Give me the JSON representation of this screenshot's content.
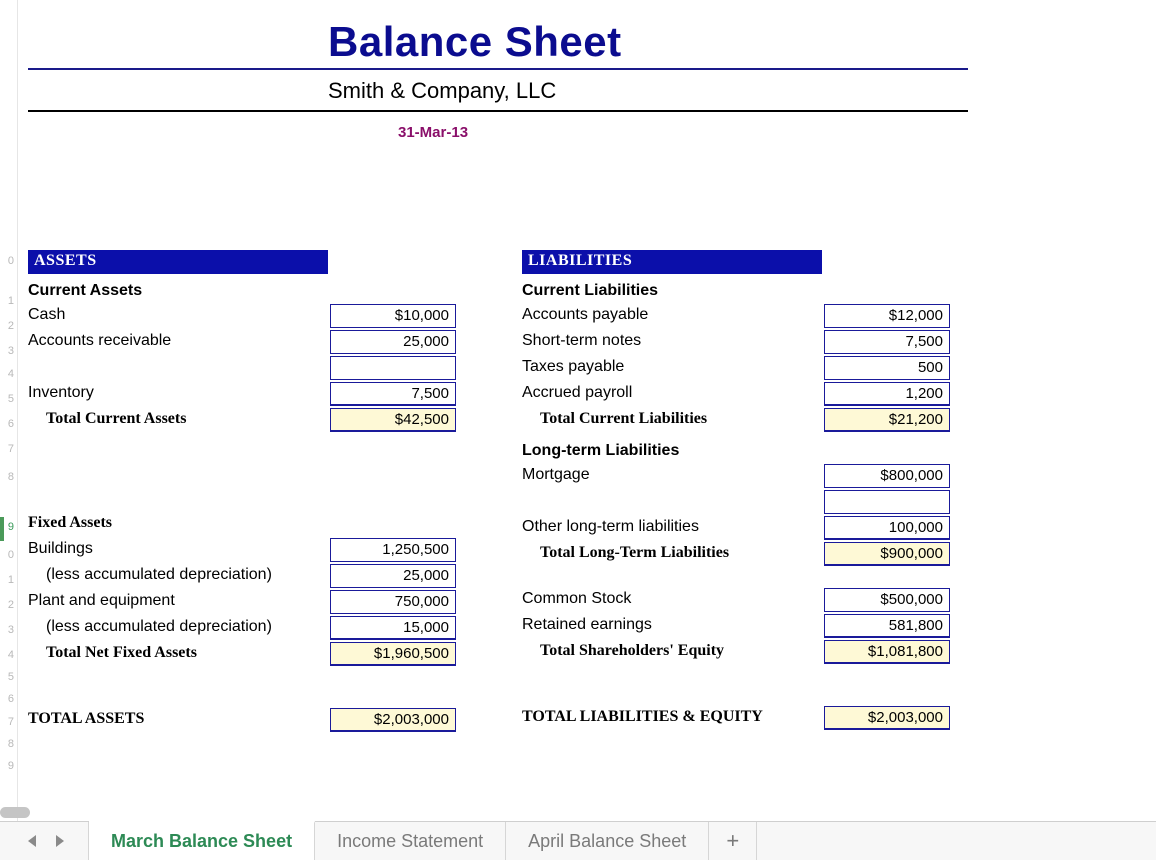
{
  "title": "Balance Sheet",
  "company": "Smith & Company, LLC",
  "date": "31-Mar-13",
  "assets": {
    "header": "ASSETS",
    "current_label": "Current Assets",
    "items": {
      "cash_label": "Cash",
      "cash_value": "$10,000",
      "ar_label": "Accounts receivable",
      "ar_value": "25,000",
      "inventory_label": "Inventory",
      "inventory_value": "7,500",
      "total_current_label": "Total Current Assets",
      "total_current_value": "$42,500"
    },
    "fixed_label": "Fixed Assets",
    "fixed": {
      "buildings_label": "Buildings",
      "buildings_value": "1,250,500",
      "buildings_dep_label": "(less accumulated depreciation)",
      "buildings_dep_value": "25,000",
      "plant_label": "Plant and equipment",
      "plant_value": "750,000",
      "plant_dep_label": "(less accumulated depreciation)",
      "plant_dep_value": "15,000",
      "total_net_label": "Total Net Fixed Assets",
      "total_net_value": "$1,960,500"
    },
    "grand_label": "TOTAL ASSETS",
    "grand_value": "$2,003,000"
  },
  "liab": {
    "header": "LIABILITIES",
    "current_label": "Current Liabilities",
    "items": {
      "ap_label": "Accounts payable",
      "ap_value": "$12,000",
      "stn_label": "Short-term notes",
      "stn_value": "7,500",
      "tax_label": "Taxes payable",
      "tax_value": "500",
      "payroll_label": "Accrued payroll",
      "payroll_value": "1,200",
      "total_current_label": "Total Current Liabilities",
      "total_current_value": "$21,200"
    },
    "lt_label": "Long-term Liabilities",
    "lt": {
      "mortgage_label": "Mortgage",
      "mortgage_value": "$800,000",
      "other_label": "Other long-term liabilities",
      "other_value": "100,000",
      "total_label": "Total Long-Term Liabilities",
      "total_value": "$900,000"
    },
    "equity": {
      "cs_label": "Common Stock",
      "cs_value": "$500,000",
      "re_label": "Retained earnings",
      "re_value": "581,800",
      "total_label": "Total Shareholders' Equity",
      "total_value": "$1,081,800"
    },
    "grand_label": "TOTAL LIABILITIES & EQUITY",
    "grand_value": "$2,003,000"
  },
  "tabs": {
    "t1": "March Balance Sheet",
    "t2": "Income Statement",
    "t3": "April Balance Sheet",
    "add": "+"
  },
  "rows": {
    "r0": "0",
    "r1": "1",
    "r2": "2",
    "r3": "3",
    "r4": "4",
    "r5": "5",
    "r6": "6",
    "r7": "7",
    "r8": "8",
    "r9": "9"
  }
}
